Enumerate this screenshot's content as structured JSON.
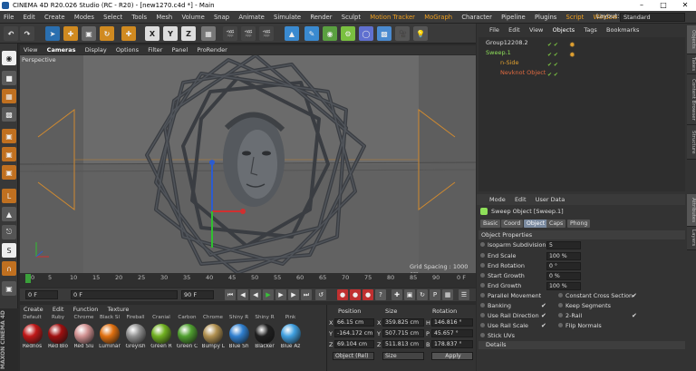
{
  "window": {
    "title": "CINEMA 4D R20.026 Studio (RC - R20) - [new1270.c4d *] - Main"
  },
  "menubar": {
    "items": [
      "File",
      "Edit",
      "Create",
      "Modes",
      "Select",
      "Tools",
      "Mesh",
      "Volume",
      "Snap",
      "Animate",
      "Simulate",
      "Render",
      "Sculpt",
      "Motion Tracker",
      "MoGraph",
      "Character",
      "Pipeline",
      "Plugins",
      "Script",
      "Window"
    ],
    "layout_label": "Layout:",
    "layout_value": "Standard"
  },
  "toolbar": {
    "axis_x": "X",
    "axis_y": "Y",
    "axis_z": "Z"
  },
  "viewport": {
    "menu": [
      "View",
      "Cameras",
      "Display",
      "Options",
      "Filter",
      "Panel",
      "ProRender"
    ],
    "label": "Perspective",
    "grid_spacing": "Grid Spacing : 1000 cm"
  },
  "timeline": {
    "ticks": [
      "0",
      "5",
      "10",
      "15",
      "20",
      "25",
      "30",
      "35",
      "40",
      "45",
      "50",
      "55",
      "60",
      "65",
      "70",
      "75",
      "80",
      "85",
      "90"
    ],
    "current_frame_end": "0 F"
  },
  "transport": {
    "start": "0 F",
    "min": "0 F",
    "max": "90 F",
    "end": "90 F"
  },
  "materials": {
    "menu": [
      "Create",
      "Edit",
      "Function",
      "Texture"
    ],
    "items": [
      {
        "top": "Default",
        "label": "Rednos",
        "color": "#c01818"
      },
      {
        "top": "Ruby",
        "label": "Red Blo",
        "color": "#a01010"
      },
      {
        "top": "Chrome",
        "label": "Red Slu",
        "color": "#d09090"
      },
      {
        "top": "Black Sl",
        "label": "Luminar",
        "color": "#e07010"
      },
      {
        "top": "Fireball",
        "label": "Greyish",
        "color": "#909090"
      },
      {
        "top": "Cranial",
        "label": "Green R",
        "color": "#70b020"
      },
      {
        "top": "Carbon",
        "label": "Green C",
        "color": "#50a030"
      },
      {
        "top": "Chrome",
        "label": "Bumpy L",
        "color": "#b09050"
      },
      {
        "top": "Shiny R",
        "label": "Blue Sh",
        "color": "#3080d0"
      },
      {
        "top": "Shiny R",
        "label": "Blacker",
        "color": "#202020"
      },
      {
        "top": "Pink",
        "label": "Blue Az",
        "color": "#40a0e0"
      }
    ]
  },
  "coordinates": {
    "headers": {
      "position": "Position",
      "size": "Size",
      "rotation": "Rotation"
    },
    "rows": [
      {
        "axis": "X",
        "pos": "66.15 cm",
        "size_axis": "X",
        "size": "359.825 cm",
        "rot_axis": "H",
        "rot": "146.816 °"
      },
      {
        "axis": "Y",
        "pos": "-164.172 cm",
        "size_axis": "Y",
        "size": "507.715 cm",
        "rot_axis": "P",
        "rot": "45.657 °"
      },
      {
        "axis": "Z",
        "pos": "69.104 cm",
        "size_axis": "Z",
        "size": "511.813 cm",
        "rot_axis": "B",
        "rot": "178.837 °"
      }
    ],
    "mode": "Object (Rel)",
    "size_mode": "Size",
    "apply": "Apply"
  },
  "objects": {
    "menu": [
      "File",
      "Edit",
      "View",
      "Objects",
      "Tags",
      "Bookmarks"
    ],
    "tree": [
      {
        "name": "Group12208.2",
        "color": "#dddddd"
      },
      {
        "name": "Sweep.1",
        "color": "#8fe05a"
      },
      {
        "name": "n-Side",
        "color": "#e0a030"
      },
      {
        "name": "Nevknot Object",
        "color": "#e06a40"
      }
    ]
  },
  "attributes": {
    "menu": [
      "Mode",
      "Edit",
      "User Data"
    ],
    "title": "Sweep Object [Sweep.1]",
    "tabs": [
      "Basic",
      "Coord",
      "Object",
      "Caps",
      "Phong"
    ],
    "section": "Object Properties",
    "props": [
      {
        "label": "Isoparm Subdivision",
        "value": "5"
      },
      {
        "label": "End Scale",
        "value": "100 %"
      },
      {
        "label": "End Rotation",
        "value": "0 °"
      },
      {
        "label": "Start Growth",
        "value": "0 %"
      },
      {
        "label": "End Growth",
        "value": "100 %"
      }
    ],
    "checks_left": [
      {
        "label": "Parallel Movement",
        "checked": ""
      },
      {
        "label": "Banking",
        "checked": "✔"
      },
      {
        "label": "Use Rail Direction",
        "checked": "✔"
      },
      {
        "label": "Use Rail Scale",
        "checked": "✔"
      },
      {
        "label": "Stick UVs",
        "checked": ""
      }
    ],
    "checks_right": [
      {
        "label": "Constant Cross Section",
        "checked": "✔"
      },
      {
        "label": "Keep Segments",
        "checked": ""
      },
      {
        "label": "2-Rail",
        "checked": "✔"
      },
      {
        "label": "Flip Normals",
        "checked": ""
      }
    ],
    "details": "Details"
  },
  "sidetabs": [
    "Objects",
    "Takes",
    "Content Browser",
    "Structure",
    "Attributes",
    "Layers"
  ],
  "branding": "MAXON CINEMA 4D"
}
